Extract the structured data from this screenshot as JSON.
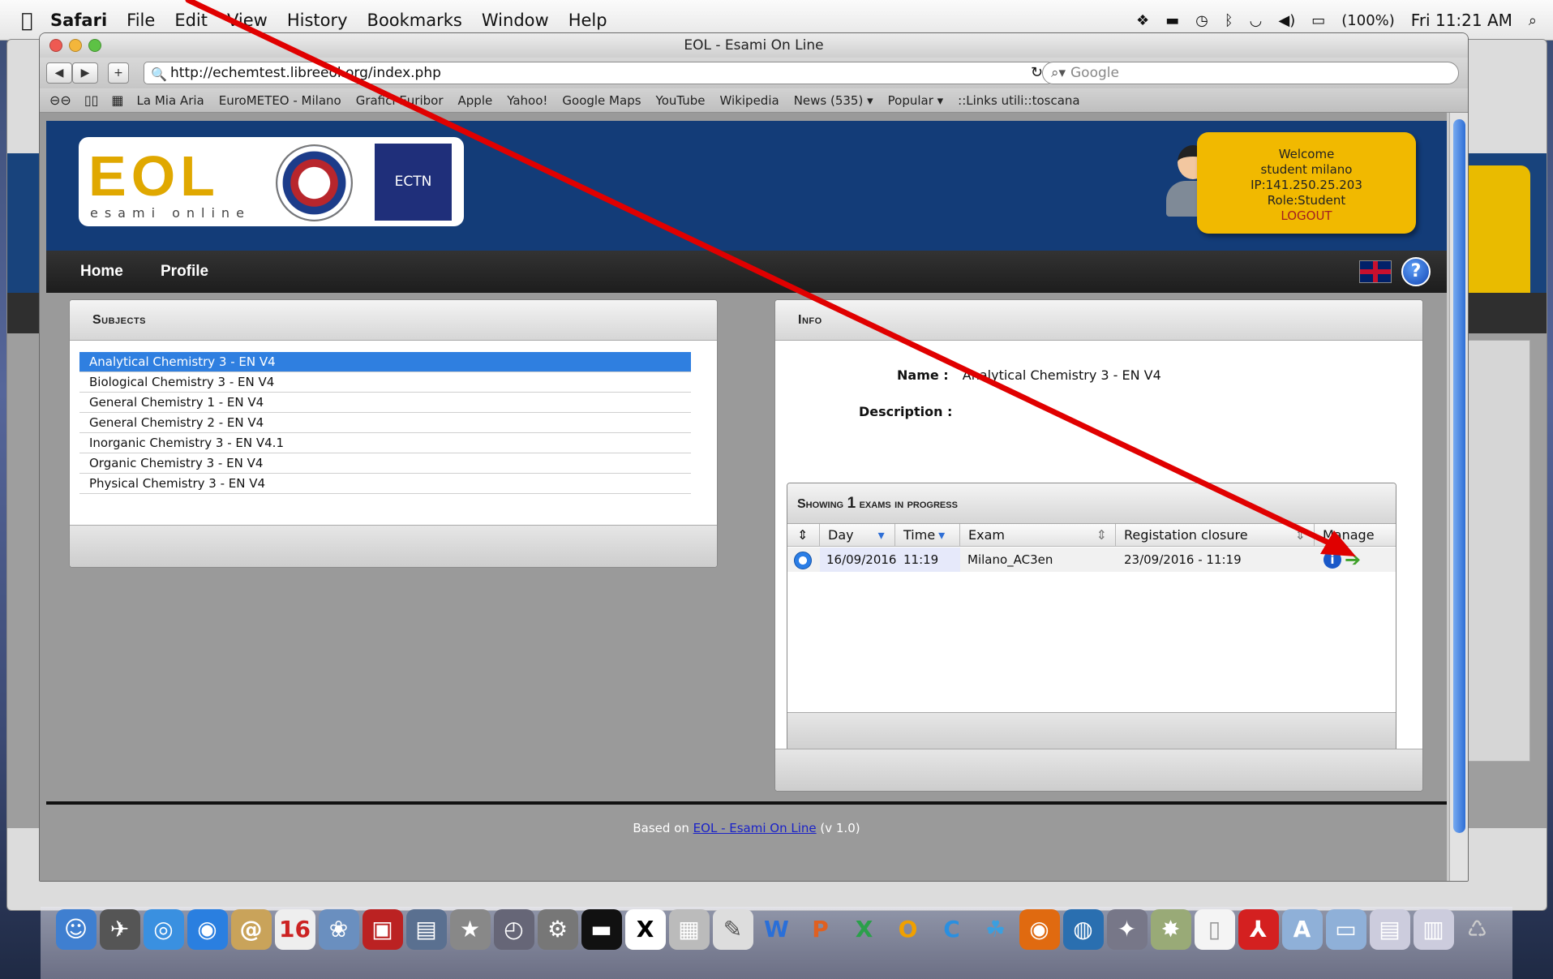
{
  "menubar": {
    "app": "Safari",
    "items": [
      "File",
      "Edit",
      "View",
      "History",
      "Bookmarks",
      "Window",
      "Help"
    ],
    "status": {
      "battery": "(100%)",
      "clock": "Fri 11:21 AM"
    }
  },
  "window": {
    "title": "EOL - Esami On Line",
    "url": "http://echemtest.libreeol.org/index.php",
    "search_placeholder": "Google",
    "bookmarks": [
      "La Mia Aria",
      "EuroMETEO - Milano",
      "Grafici Euribor",
      "Apple",
      "Yahoo!",
      "Google Maps",
      "YouTube",
      "Wikipedia",
      "News (535) ▾",
      "Popular ▾",
      "::Links utili::toscana"
    ]
  },
  "header": {
    "logo_text": "EOL",
    "logo_sub": "esami online",
    "ectn": "ECTN",
    "welcome": {
      "line1": "Welcome",
      "line2": "student milano",
      "line3": "IP:141.250.25.203",
      "line4": "Role:Student",
      "logout": "LOGOUT"
    }
  },
  "nav": {
    "home": "Home",
    "profile": "Profile"
  },
  "subjects": {
    "title": "Subjects",
    "items": [
      "Analytical Chemistry 3 - EN V4",
      "Biological Chemistry 3 - EN V4",
      "General Chemistry 1 - EN V4",
      "General Chemistry 2 - EN V4",
      "Inorganic Chemistry 3 - EN V4.1",
      "Organic Chemistry 3 - EN V4",
      "Physical Chemistry 3 - EN V4"
    ],
    "selected_index": 0
  },
  "info": {
    "title": "Info",
    "name_label": "Name :",
    "name_value": "Analytical Chemistry 3 - EN V4",
    "desc_label": "Description :",
    "exams": {
      "header_pre": "Showing ",
      "header_count": "1",
      "header_post": " exams in progress",
      "columns": {
        "day": "Day",
        "time": "Time",
        "exam": "Exam",
        "closure": "Registation closure",
        "manage": "Manage"
      },
      "rows": [
        {
          "day": "16/09/2016",
          "time": "11:19",
          "exam": "Milano_AC3en",
          "closure": "23/09/2016 - 11:19"
        }
      ]
    }
  },
  "footer": {
    "pre": "Based on ",
    "link": "EOL - Esami On Line",
    "post": " (v 1.0)"
  },
  "colors": {
    "header_blue": "#133c78",
    "accent_yellow": "#f1b900",
    "selection_blue": "#2f7fe0",
    "annotation_red": "#e00000"
  }
}
